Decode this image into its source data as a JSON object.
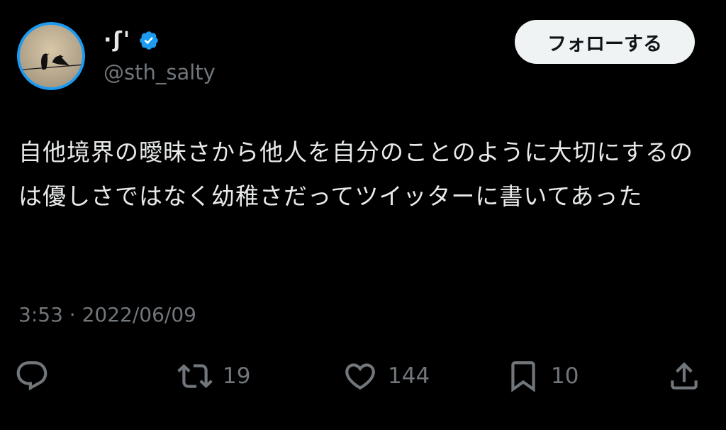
{
  "user": {
    "display_name": "·ʃ'",
    "handle": "@sth_salty",
    "verified": true
  },
  "follow_label": "フォローする",
  "tweet": {
    "text": "自他境界の曖昧さから他人を自分のことのように大切にするのは優しさではなく幼稚さだってツイッターに書いてあった",
    "timestamp": "3:53 · 2022/06/09"
  },
  "actions": {
    "retweets": "19",
    "likes": "144",
    "bookmarks": "10"
  },
  "colors": {
    "background": "#000000",
    "text": "#e7e9ea",
    "muted": "#71767b",
    "accent": "#1d9bf0",
    "button_bg": "#eff3f4"
  },
  "icons": [
    "reply-icon",
    "retweet-icon",
    "like-icon",
    "bookmark-icon",
    "share-icon",
    "verified-badge-icon"
  ]
}
